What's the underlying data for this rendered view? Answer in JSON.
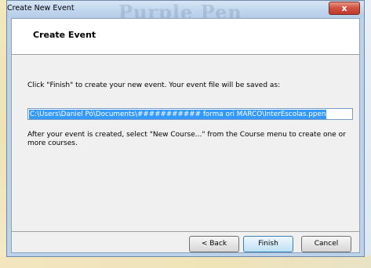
{
  "window": {
    "title": "Create New Event",
    "watermark": "Purple Pen",
    "close_label": "x"
  },
  "header": {
    "title": "Create Event"
  },
  "body": {
    "instruction": "Click \"Finish\" to create your new event. Your event file will be saved as:",
    "file_path": "C:\\Users\\Daniel Pó\\Documents\\########### forma ori MARCO\\InterEscolas.ppen",
    "after_text": "After your event is created, select \"New Course...\" from the Course menu to create one or more courses."
  },
  "buttons": {
    "back": "< Back",
    "finish": "Finish",
    "cancel": "Cancel"
  }
}
